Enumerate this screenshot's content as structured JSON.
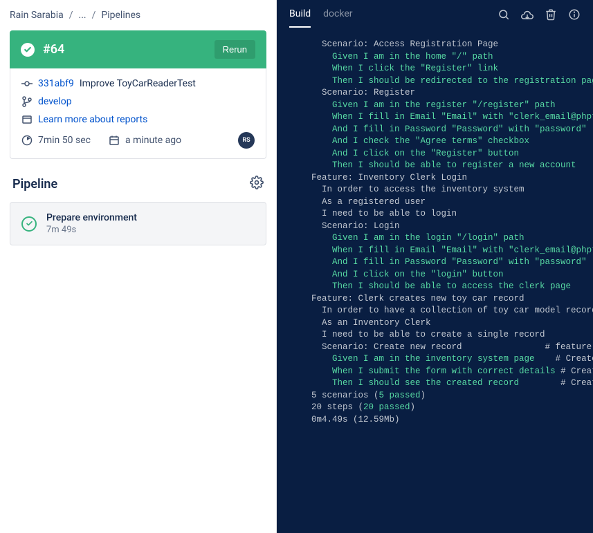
{
  "breadcrumb": {
    "owner": "Rain Sarabia",
    "mid": "...",
    "page": "Pipelines"
  },
  "build": {
    "number_label": "#64",
    "rerun_label": "Rerun",
    "commit_hash": "331abf9",
    "commit_message": "Improve ToyCarReaderTest",
    "branch": "develop",
    "reports_label": "Learn more about reports",
    "duration": "7min 50 sec",
    "finished": "a minute ago",
    "avatar_initials": "RS"
  },
  "pipeline": {
    "title": "Pipeline",
    "step_name": "Prepare environment",
    "step_duration": "7m 49s"
  },
  "console": {
    "tabs": {
      "build": "Build",
      "docker": "docker"
    },
    "lines": [
      {
        "indent": 1,
        "cls": "cw",
        "text": "Scenario: Access Registration Page"
      },
      {
        "indent": 2,
        "cls": "cg",
        "text": "Given I am in the home \"/\" path"
      },
      {
        "indent": 2,
        "cls": "cg",
        "text": "When I click the \"Register\" link"
      },
      {
        "indent": 2,
        "cls": "cg",
        "text": "Then I should be redirected to the registration page"
      },
      {
        "indent": 0,
        "cls": "cw",
        "text": ""
      },
      {
        "indent": 1,
        "cls": "cw",
        "text": "Scenario: Register"
      },
      {
        "indent": 2,
        "cls": "cg",
        "text": "Given I am in the register \"/register\" path"
      },
      {
        "indent": 2,
        "cls": "cg",
        "text": "When I fill in Email \"Email\" with \"clerk_email@phptdd"
      },
      {
        "indent": 2,
        "cls": "cg",
        "text": "And I fill in Password \"Password\" with \"password\""
      },
      {
        "indent": 2,
        "cls": "cg",
        "text": "And I check the \"Agree terms\" checkbox"
      },
      {
        "indent": 2,
        "cls": "cg",
        "text": "And I click on the \"Register\" button"
      },
      {
        "indent": 2,
        "cls": "cg",
        "text": "Then I should be able to register a new account"
      },
      {
        "indent": 0,
        "cls": "cw",
        "text": ""
      },
      {
        "indent": 0,
        "cls": "cw",
        "text": "Feature: Inventory Clerk Login"
      },
      {
        "indent": 1,
        "cls": "cw",
        "text": "In order to access the inventory system"
      },
      {
        "indent": 1,
        "cls": "cw",
        "text": "As a registered user"
      },
      {
        "indent": 1,
        "cls": "cw",
        "text": "I need to be able to login"
      },
      {
        "indent": 0,
        "cls": "cw",
        "text": ""
      },
      {
        "indent": 1,
        "cls": "cw",
        "text": "Scenario: Login"
      },
      {
        "indent": 2,
        "cls": "cg",
        "text": "Given I am in the login \"/login\" path"
      },
      {
        "indent": 2,
        "cls": "cg",
        "text": "When I fill in Email \"Email\" with \"clerk_email@phptdd"
      },
      {
        "indent": 2,
        "cls": "cg",
        "text": "And I fill in Password \"Password\" with \"password\""
      },
      {
        "indent": 2,
        "cls": "cg",
        "text": "And I click on the \"login\" button"
      },
      {
        "indent": 2,
        "cls": "cg",
        "text": "Then I should be able to access the clerk page"
      },
      {
        "indent": 0,
        "cls": "cw",
        "text": ""
      },
      {
        "indent": 0,
        "cls": "cw",
        "text": "Feature: Clerk creates new toy car record"
      },
      {
        "indent": 1,
        "cls": "cw",
        "text": "In order to have a collection of toy car model records"
      },
      {
        "indent": 1,
        "cls": "cw",
        "text": "As an Inventory Clerk"
      },
      {
        "indent": 1,
        "cls": "cw",
        "text": "I need to be able to create a single record"
      },
      {
        "indent": 0,
        "cls": "cw",
        "text": ""
      },
      {
        "indent": 1,
        "cls": "cw",
        "text": "Scenario: Create new record                # feature"
      },
      {
        "indent": 2,
        "spans": [
          {
            "cls": "cg",
            "text": "Given I am in the inventory system page"
          },
          {
            "cls": "cw",
            "text": "    # CreateT"
          }
        ]
      },
      {
        "indent": 2,
        "spans": [
          {
            "cls": "cg",
            "text": "When I submit the form with correct details"
          },
          {
            "cls": "cw",
            "text": " # CreateT"
          }
        ]
      },
      {
        "indent": 2,
        "spans": [
          {
            "cls": "cg",
            "text": "Then I should see the created record"
          },
          {
            "cls": "cw",
            "text": "        # CreateT"
          }
        ]
      },
      {
        "indent": 0,
        "cls": "cw",
        "text": ""
      },
      {
        "indent": 0,
        "spans": [
          {
            "cls": "cw",
            "text": "5 scenarios ("
          },
          {
            "cls": "cg",
            "text": "5 passed"
          },
          {
            "cls": "cw",
            "text": ")"
          }
        ]
      },
      {
        "indent": 0,
        "spans": [
          {
            "cls": "cw",
            "text": "20 steps ("
          },
          {
            "cls": "cg",
            "text": "20 passed"
          },
          {
            "cls": "cw",
            "text": ")"
          }
        ]
      },
      {
        "indent": 0,
        "cls": "cw",
        "text": "0m4.49s (12.59Mb)"
      }
    ]
  }
}
